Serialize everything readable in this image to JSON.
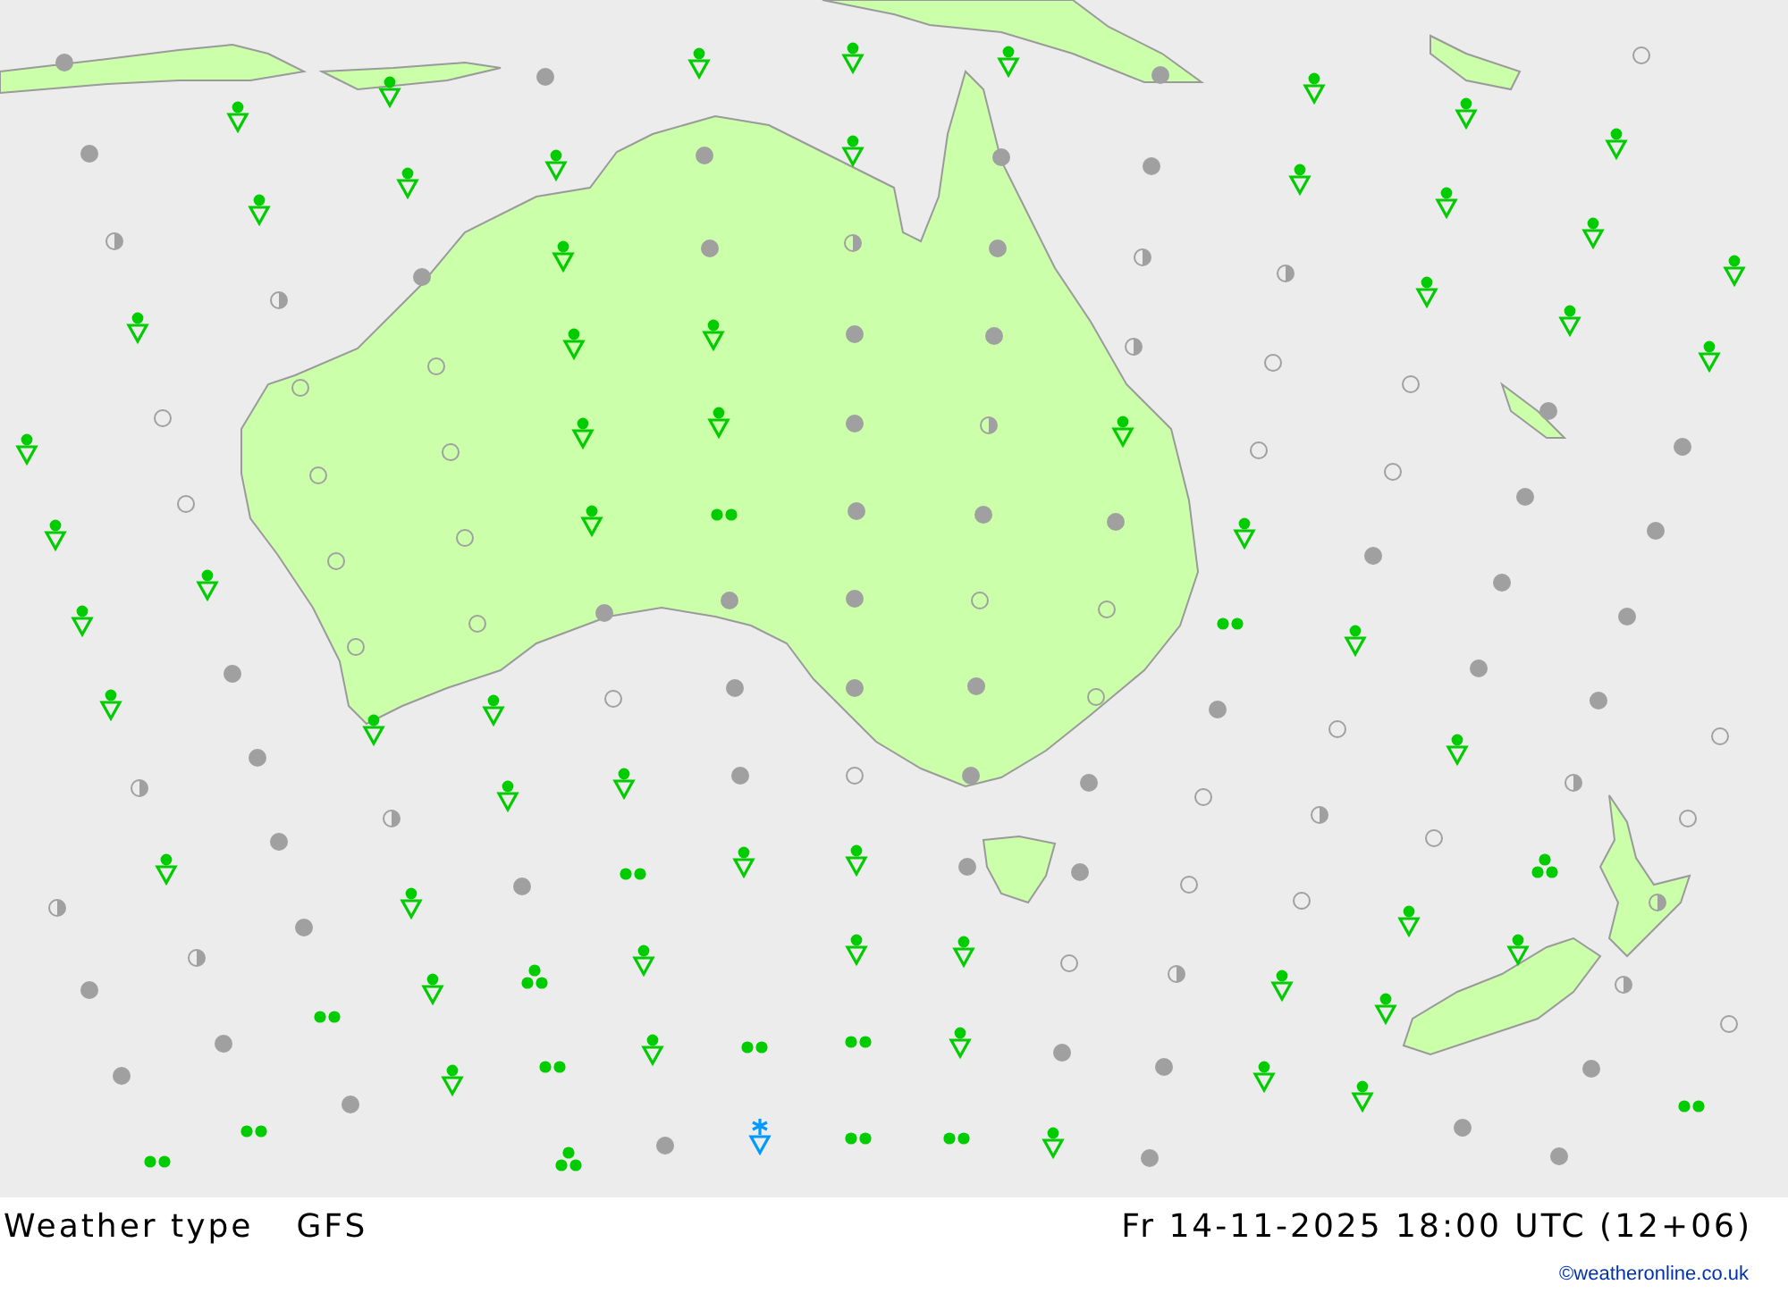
{
  "footer": {
    "title": "Weather type",
    "model": "GFS",
    "valid_time": "Fr 14-11-2025 18:00 UTC (12+06)",
    "credit": "©weatheronline.co.uk"
  }
}
